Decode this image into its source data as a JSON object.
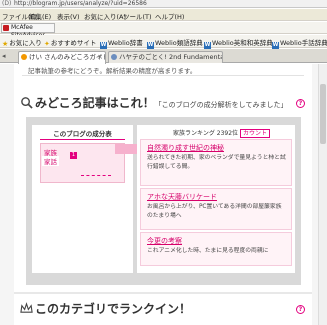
{
  "browser": {
    "address": {
      "label": "(D)",
      "url": "http://blogram.jp/users/analyze/?uid=26586"
    },
    "menu": [
      "ファイル(F)",
      "編集(E)",
      "表示(V)",
      "お気に入り(A)",
      "ツール(T)",
      "ヘルプ(H)"
    ],
    "toolbar": {
      "mcafee_label": "McAfee SiteAdvisor"
    },
    "bookmarks": [
      "お気に入り",
      "おすすめサイト",
      "Weblio辞書",
      "Weblio類語辞典",
      "Weblio英和和英辞典",
      "Weblio手話辞典"
    ],
    "tabs": [
      "けい さんのみどころガイド...",
      "ハヤテのごとく! 2nd Fundamental..."
    ]
  },
  "page": {
    "intro": "記事執筆の参考にどうぞ。解析結果の精度が高まります。",
    "section1": {
      "title": "みどころ記事はこれ！",
      "subtitle": "「このブログの成分解析をしてみました」",
      "help": "?"
    },
    "components": {
      "title": "このブログの成分表",
      "categories": [
        "家族",
        "家話"
      ],
      "badge": "1"
    },
    "ranking": {
      "label": "家族ランキング",
      "rank": "2392位",
      "badge": "カウント"
    },
    "articles": [
      {
        "title": "自然濁り成す世紀の神秘",
        "body": "送られてきた初期、家のベランダで量見ようと柿と試行錯誤してる間。"
      },
      {
        "title": "アホな天藤バリケード",
        "body": "お風呂から上がり、PC置いてある洋間の部屋簾家族のたまり場へ"
      },
      {
        "title": "今更の考察",
        "body": "これアニメ化した時、たまに見る程度の両親に"
      }
    ],
    "section2": {
      "title": "このカテゴリでランクイン！",
      "help": "?"
    }
  },
  "colors": {
    "accent": "#e3007f",
    "panel": "#d9d9d9",
    "pink_bg": "#fde6ef"
  }
}
